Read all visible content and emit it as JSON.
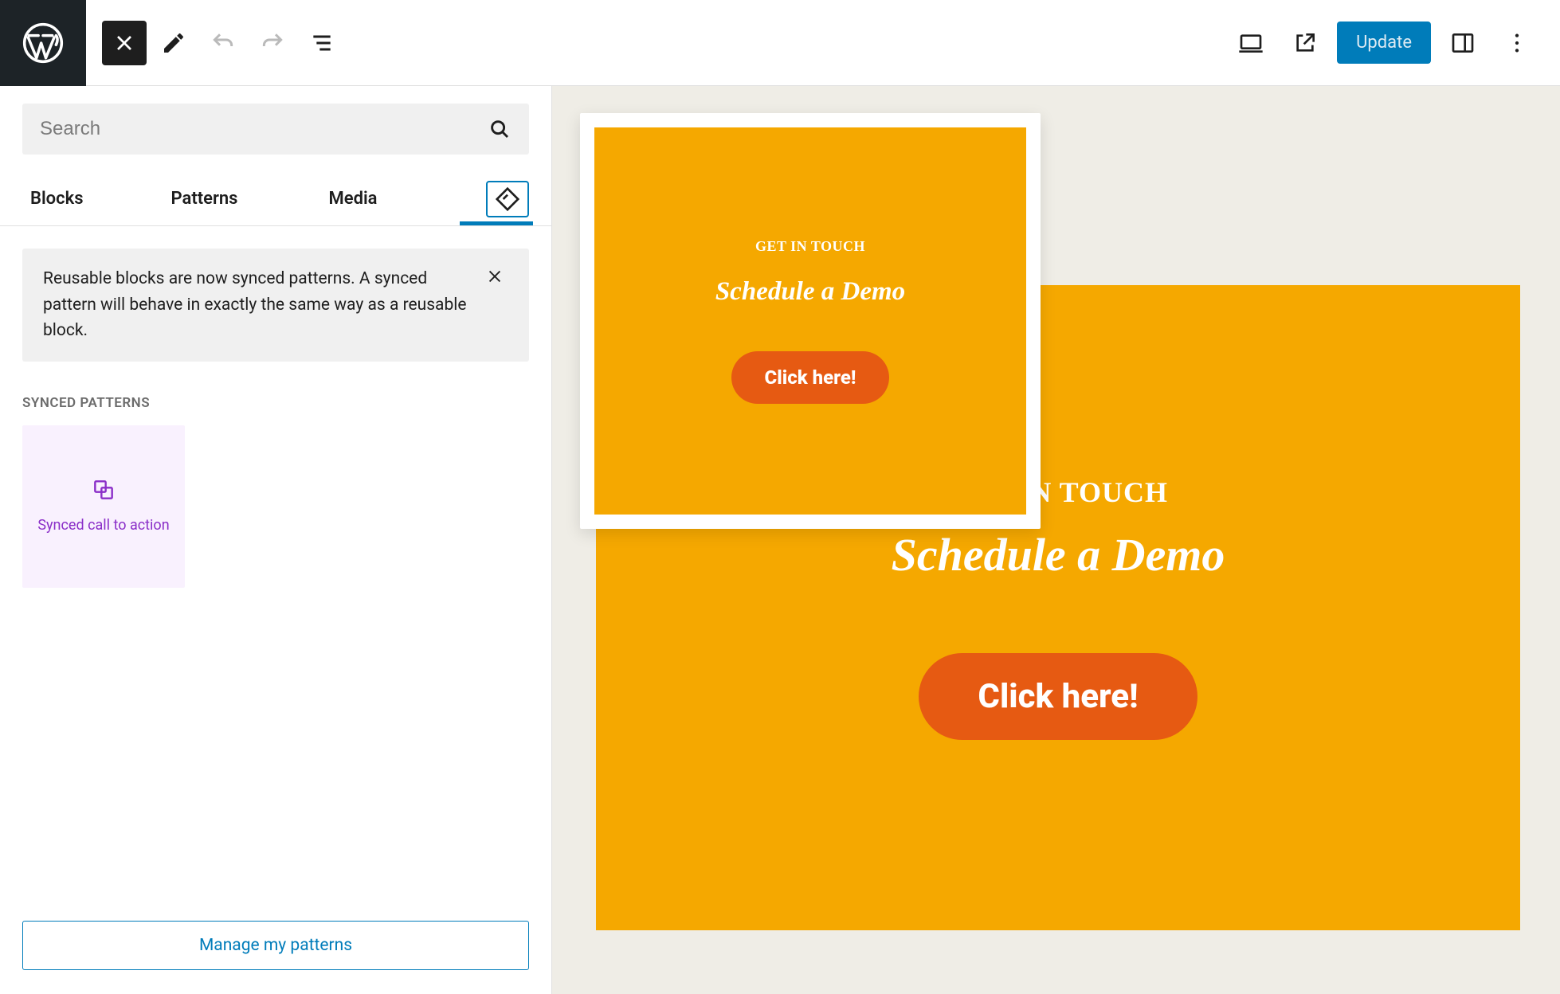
{
  "topbar": {
    "update_label": "Update"
  },
  "inserter": {
    "search_placeholder": "Search",
    "tabs": {
      "blocks": "Blocks",
      "patterns": "Patterns",
      "media": "Media"
    },
    "notice": "Reusable blocks are now synced patterns. A synced pattern will behave in exactly the same way as a reusable block.",
    "synced_heading": "SYNCED PATTERNS",
    "patterns": [
      {
        "label": "Synced call to action"
      }
    ],
    "manage_label": "Manage my patterns"
  },
  "cta": {
    "eyebrow": "GET IN TOUCH",
    "heading": "Schedule a Demo",
    "button": "Click here!"
  }
}
